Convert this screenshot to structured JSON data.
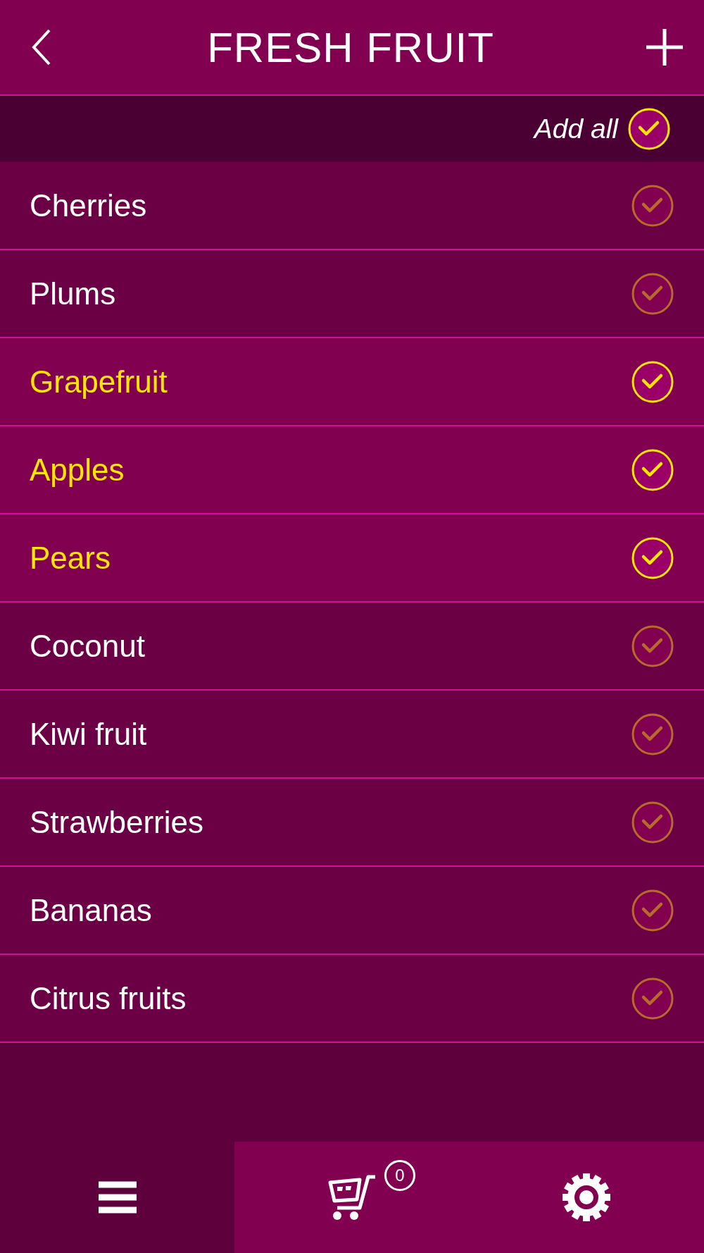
{
  "header": {
    "title": "FRESH FRUIT"
  },
  "add_all": {
    "label": "Add all",
    "checked": true
  },
  "items": [
    {
      "name": "Cherries",
      "checked": false
    },
    {
      "name": "Plums",
      "checked": false
    },
    {
      "name": "Grapefruit",
      "checked": true
    },
    {
      "name": "Apples",
      "checked": true
    },
    {
      "name": "Pears",
      "checked": true
    },
    {
      "name": "Coconut",
      "checked": false
    },
    {
      "name": "Kiwi fruit",
      "checked": false
    },
    {
      "name": "Strawberries",
      "checked": false
    },
    {
      "name": "Bananas",
      "checked": false
    },
    {
      "name": "Citrus fruits",
      "checked": false
    }
  ],
  "tab_bar": [
    {
      "kind": "menu",
      "selected": true
    },
    {
      "kind": "cart",
      "selected": false,
      "badge": "0"
    },
    {
      "kind": "settings",
      "selected": false
    }
  ]
}
